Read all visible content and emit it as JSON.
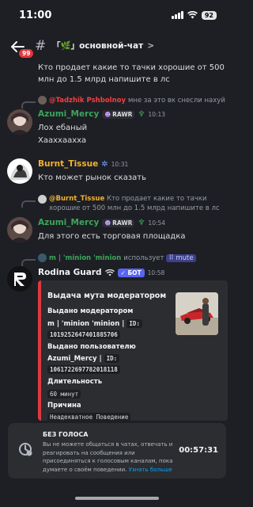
{
  "status_bar": {
    "time": "11:00",
    "battery": "92"
  },
  "header": {
    "badge": "99",
    "channel_name": "「🌿」основной-чат",
    "chevron": ">"
  },
  "messages": [
    {
      "text": "Кто продает какие то тачки хорошие от 500 млн до 1.5 млрд напишите в лс"
    },
    {
      "reply_user": "@Tadzhik Pshbolnoy",
      "reply_text": "мне за это вк снесли нахуй",
      "username": "Azumi_Mercy",
      "tag": "RAWR",
      "time": "10:13",
      "lines": [
        "Лох ебаный",
        "Хаахха͏ахха"
      ]
    },
    {
      "username": "Burnt_Tissue",
      "time": "10:31",
      "lines": [
        "Кто может рынок сказать"
      ]
    },
    {
      "reply_user": "@Burnt_Tissue",
      "reply_text": "Кто продает какие то тачки хорошие от 500 млн до 1.5 млрд напишите в лс",
      "username": "Azumi_Mercy",
      "tag": "RAWR",
      "time": "10:54",
      "lines": [
        "Для этого есть торговая площадка"
      ]
    }
  ],
  "bot_message": {
    "command_user": "m | 'minion 'minion",
    "command_verb": "использует",
    "command_name": "mute",
    "username": "Rodina Guard",
    "bot_tag": "БОТ",
    "time": "10:58",
    "embed": {
      "title": "Выдача мута модератором",
      "f1_label": "Выдано модератором",
      "f1_name": "m | 'minion 'minion |",
      "f1_id_label": "ID:",
      "f1_id": "1019252647401885706",
      "f2_label": "Выдано пользователю",
      "f2_name": "Azumi_Mercy |",
      "f2_id_label": "ID:",
      "f2_id": "1061722697782018118",
      "f3_label": "Длительность",
      "f3_value": "60 минут",
      "f4_label": "Причина",
      "f4_value": "Неадекватное Поведение"
    }
  },
  "mute_notice": {
    "title": "БЕЗ ГОЛОСА",
    "body": "Вы не можете общаться в чатах, отвечать и реагировать на сообщения или присоединяться к голосовым каналам, пока думаете о своём поведении.",
    "link": "Узнать больше",
    "timer": "00:57:31"
  },
  "colors": {
    "azumi": "#3ba55c",
    "burnt": "#f0b232",
    "tadzhik": "#f23f43",
    "bot_tag": "#5865f2",
    "embed_accent": "#e0383e"
  }
}
